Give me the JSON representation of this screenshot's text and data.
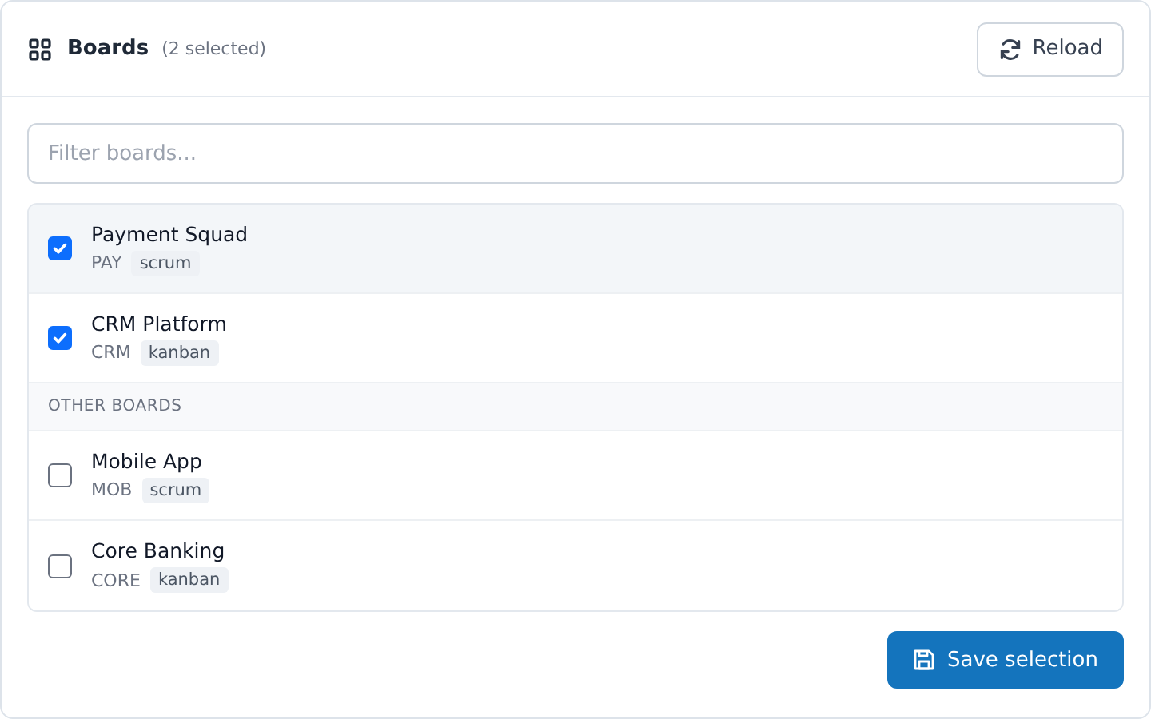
{
  "header": {
    "title": "Boards",
    "count": "(2 selected)",
    "reload_button": "Reload"
  },
  "filter": {
    "placeholder": "Filter boards..."
  },
  "list": [
    {
      "kind": "board",
      "name": "Payment Squad",
      "key": "PAY",
      "tag": "scrum",
      "checked": true,
      "selected": true
    },
    {
      "kind": "board",
      "name": "CRM Platform",
      "key": "CRM",
      "tag": "kanban",
      "checked": true,
      "selected": false
    },
    {
      "kind": "section",
      "label": "OTHER BOARDS"
    },
    {
      "kind": "board",
      "name": "Mobile App",
      "key": "MOB",
      "tag": "scrum",
      "checked": false,
      "selected": false
    },
    {
      "kind": "board",
      "name": "Core Banking",
      "key": "CORE",
      "tag": "kanban",
      "checked": false,
      "selected": false
    }
  ],
  "save_button": "Save selection"
}
